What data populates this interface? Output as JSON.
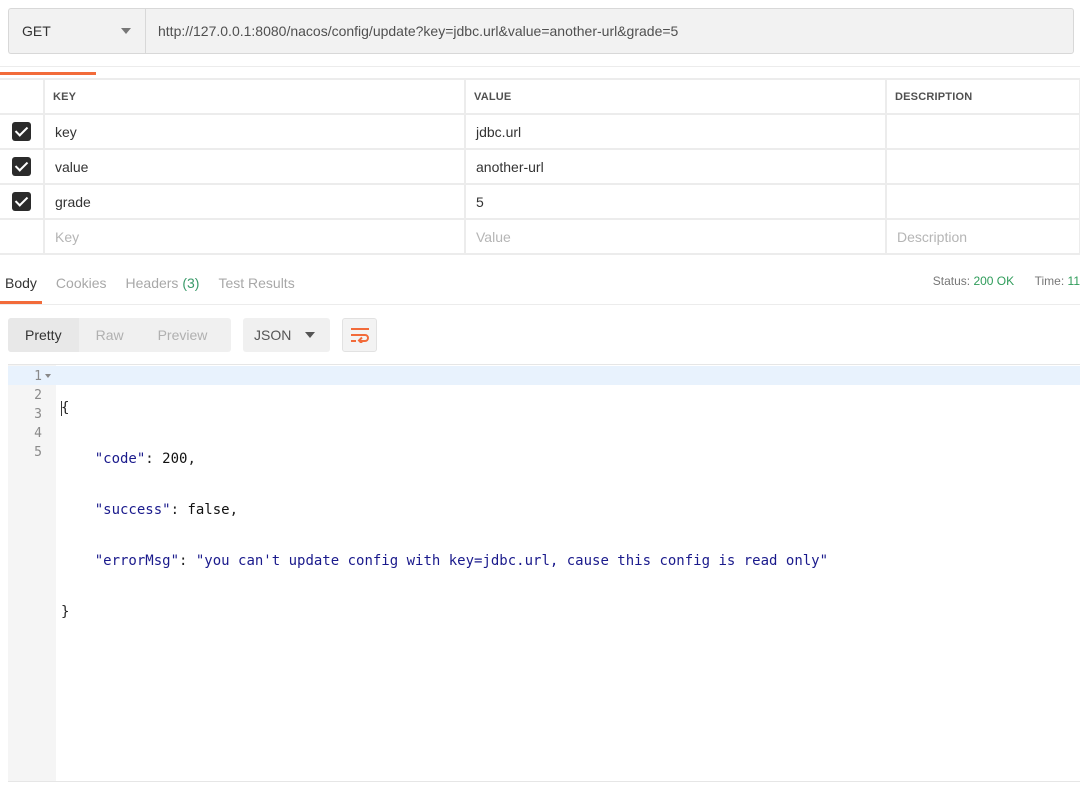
{
  "request": {
    "method": "GET",
    "url": "http://127.0.0.1:8080/nacos/config/update?key=jdbc.url&value=another-url&grade=5"
  },
  "params": {
    "headers": [
      "KEY",
      "VALUE",
      "DESCRIPTION"
    ],
    "rows": [
      {
        "key": "key",
        "value": "jdbc.url",
        "description": ""
      },
      {
        "key": "value",
        "value": "another-url",
        "description": ""
      },
      {
        "key": "grade",
        "value": "5",
        "description": ""
      }
    ],
    "placeholders": {
      "key": "Key",
      "value": "Value",
      "description": "Description"
    }
  },
  "response": {
    "tabs": [
      "Body",
      "Cookies",
      "Headers",
      "Test Results"
    ],
    "headers_count": "(3)",
    "status_label": "Status:",
    "status_value": "200 OK",
    "time_label": "Time:",
    "time_value": "11"
  },
  "view": {
    "modes": [
      "Pretty",
      "Raw",
      "Preview"
    ],
    "format": "JSON"
  },
  "body": {
    "line_numbers": [
      "1",
      "2",
      "3",
      "4",
      "5"
    ],
    "lines": {
      "open": "{",
      "code_key": "\"code\"",
      "code_val": "200",
      "success_key": "\"success\"",
      "success_val": "false",
      "error_key": "\"errorMsg\"",
      "error_val": "\"you can't update config with key=jdbc.url, cause this config is read only\"",
      "close": "}"
    }
  },
  "colors": {
    "accent": "#f26b3a",
    "status_ok": "#2f9c5a",
    "json_string": "#1a1a8c"
  }
}
